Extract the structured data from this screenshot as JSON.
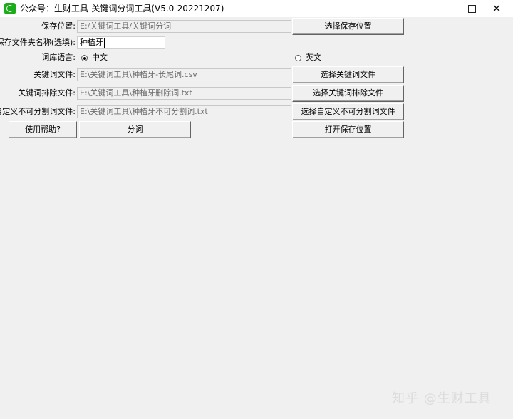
{
  "window": {
    "title": "公众号：生财工具-关键词分词工具(V5.0-20221207)",
    "minimize": "—",
    "maximize": "☐",
    "close": "✕"
  },
  "form": {
    "save_location": {
      "label": "保存位置:",
      "value": "E:/关键词工具/关键词分词",
      "button": "选择保存位置"
    },
    "folder_name": {
      "label": "保存文件夹名称(选填):",
      "value": "种植牙"
    },
    "language": {
      "label": "词库语言:",
      "options": [
        {
          "label": "中文",
          "selected": true
        },
        {
          "label": "英文",
          "selected": false
        }
      ]
    },
    "keyword_file": {
      "label": "关键词文件:",
      "value": "E:\\关键词工具\\种植牙-长尾词.csv",
      "button": "选择关键词文件"
    },
    "exclude_file": {
      "label": "关键词排除文件:",
      "value": "E:\\关键词工具\\种植牙删除词.txt",
      "button": "选择关键词排除文件"
    },
    "nosplit_file": {
      "label": "自定义不可分割词文件:",
      "value": "E:\\关键词工具\\种植牙不可分割词.txt",
      "button": "选择自定义不可分割词文件"
    }
  },
  "actions": {
    "help": "使用帮助?",
    "segment": "分词",
    "open_save": "打开保存位置"
  },
  "watermark": "知乎 @生财工具"
}
